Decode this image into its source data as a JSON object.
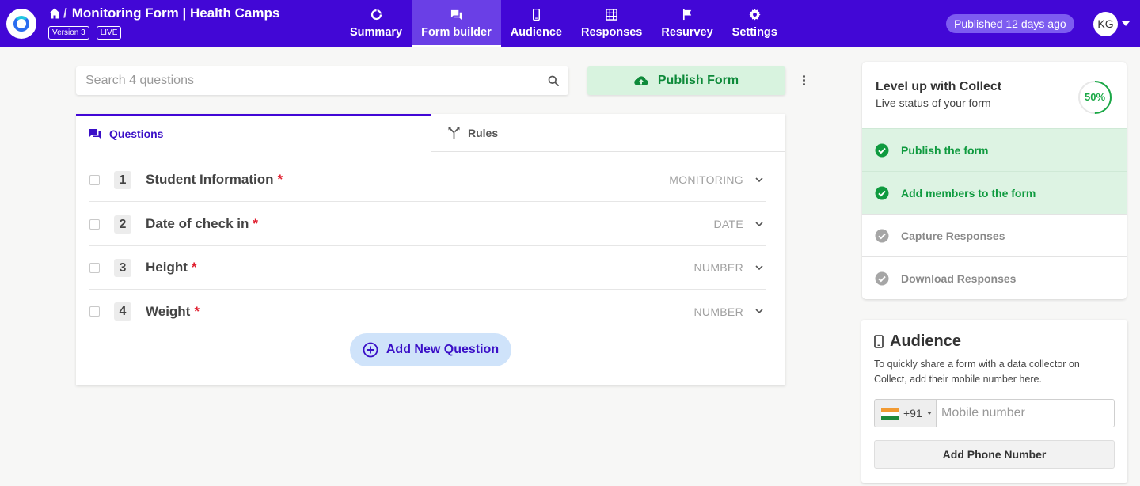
{
  "header": {
    "title": "Monitoring Form | Health Camps",
    "version_badge": "Version 3",
    "status_badge": "LIVE",
    "published_text": "Published 12 days ago",
    "avatar_initials": "KG"
  },
  "nav": {
    "items": [
      {
        "label": "Summary",
        "icon": "summary-icon"
      },
      {
        "label": "Form builder",
        "icon": "form-builder-icon",
        "active": true
      },
      {
        "label": "Audience",
        "icon": "mobile-icon"
      },
      {
        "label": "Responses",
        "icon": "grid-icon"
      },
      {
        "label": "Resurvey",
        "icon": "flag-icon"
      },
      {
        "label": "Settings",
        "icon": "gear-icon"
      }
    ]
  },
  "search": {
    "placeholder": "Search 4 questions",
    "value": ""
  },
  "publish_button": {
    "label": "Publish Form",
    "icon": "cloud-upload-icon"
  },
  "tabs": {
    "questions": "Questions",
    "rules": "Rules"
  },
  "questions": [
    {
      "number": "1",
      "label": "Student Information",
      "required": "*",
      "type": "MONITORING"
    },
    {
      "number": "2",
      "label": "Date of check in",
      "required": "*",
      "type": "DATE"
    },
    {
      "number": "3",
      "label": "Height",
      "required": "*",
      "type": "NUMBER"
    },
    {
      "number": "4",
      "label": "Weight",
      "required": "*",
      "type": "NUMBER"
    }
  ],
  "add_question": {
    "label": "Add New Question"
  },
  "level_up": {
    "title": "Level up with Collect",
    "subtitle": "Live status of your form",
    "progress_text": "50%",
    "progress_fraction": 0.5,
    "steps": [
      {
        "label": "Publish the form",
        "done": true
      },
      {
        "label": "Add members to the form",
        "done": true
      },
      {
        "label": "Capture Responses",
        "done": false
      },
      {
        "label": "Download Responses",
        "done": false
      }
    ]
  },
  "audience": {
    "title": "Audience",
    "description": "To quickly share a form with a data collector on Collect, add their mobile number here.",
    "country_code": "+91",
    "phone_placeholder": "Mobile number",
    "add_button": "Add Phone Number"
  },
  "colors": {
    "brand": "#4207d6",
    "success": "#0f9a3f",
    "required": "#e01e2e"
  }
}
